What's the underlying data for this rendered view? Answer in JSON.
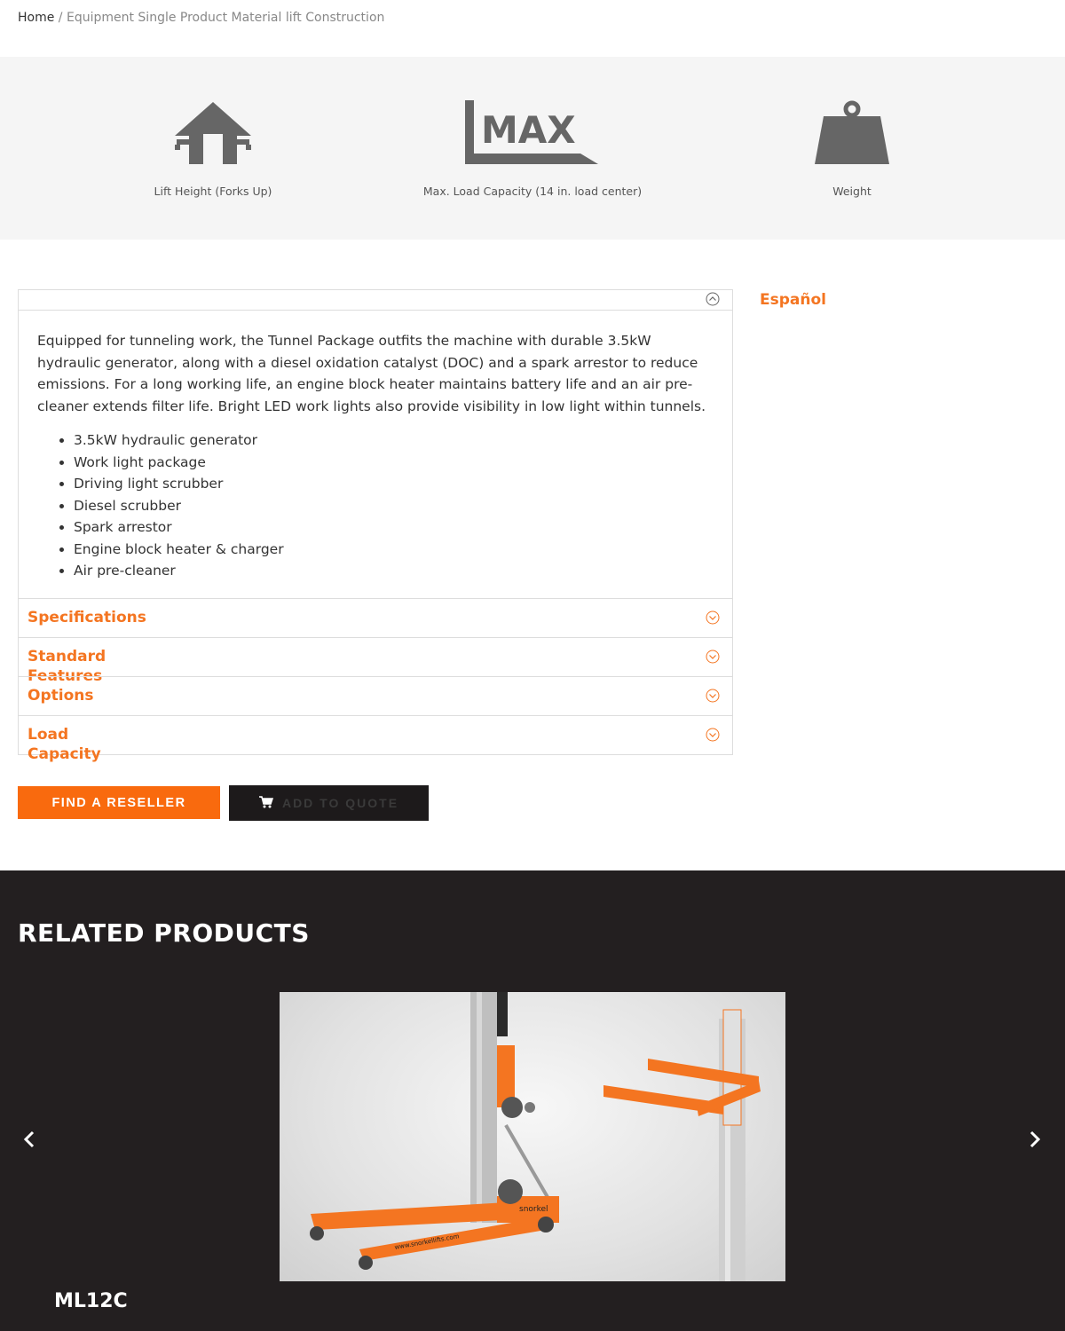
{
  "breadcrumb": {
    "home": "Home",
    "separator": "/",
    "current": "Equipment Single Product Material lift Construction"
  },
  "specs": [
    {
      "icon": "lift-height-icon",
      "label": "Lift Height (Forks Up)"
    },
    {
      "icon": "max-load-icon",
      "label": "Max. Load Capacity (14 in. load center)",
      "icon_text": "MAX"
    },
    {
      "icon": "weight-icon",
      "label": "Weight"
    }
  ],
  "accordion": {
    "open_description": "Equipped for tunneling work, the Tunnel Package outfits the machine with durable 3.5kW hydraulic generator, along with a diesel oxidation catalyst (DOC) and a spark arrestor to reduce emissions. For a long working life, an engine block heater maintains battery life and an air pre-cleaner extends filter life. Bright LED work lights also provide visibility in low light within tunnels.",
    "open_features": [
      "3.5kW hydraulic generator",
      "Work light package",
      "Driving light scrubber",
      "Diesel scrubber",
      "Spark arrestor",
      "Engine block heater & charger",
      "Air pre-cleaner"
    ],
    "sections": [
      {
        "title": "Specifications"
      },
      {
        "title": "Standard Features"
      },
      {
        "title": "Options"
      },
      {
        "title": "Load Capacity"
      }
    ]
  },
  "language_link": "Español",
  "buttons": {
    "find_reseller": "FIND A RESELLER",
    "add_to_quote": "ADD TO QUOTE"
  },
  "related": {
    "title": "RELATED PRODUCTS",
    "product_name": "ML12C",
    "image_text_brand": "snorkel",
    "image_text_url": "www.snorkellifts.com"
  },
  "colors": {
    "accent": "#f47521",
    "button_orange": "#f96a0e",
    "dark_band": "#231f20",
    "icon_gray": "#666666"
  }
}
